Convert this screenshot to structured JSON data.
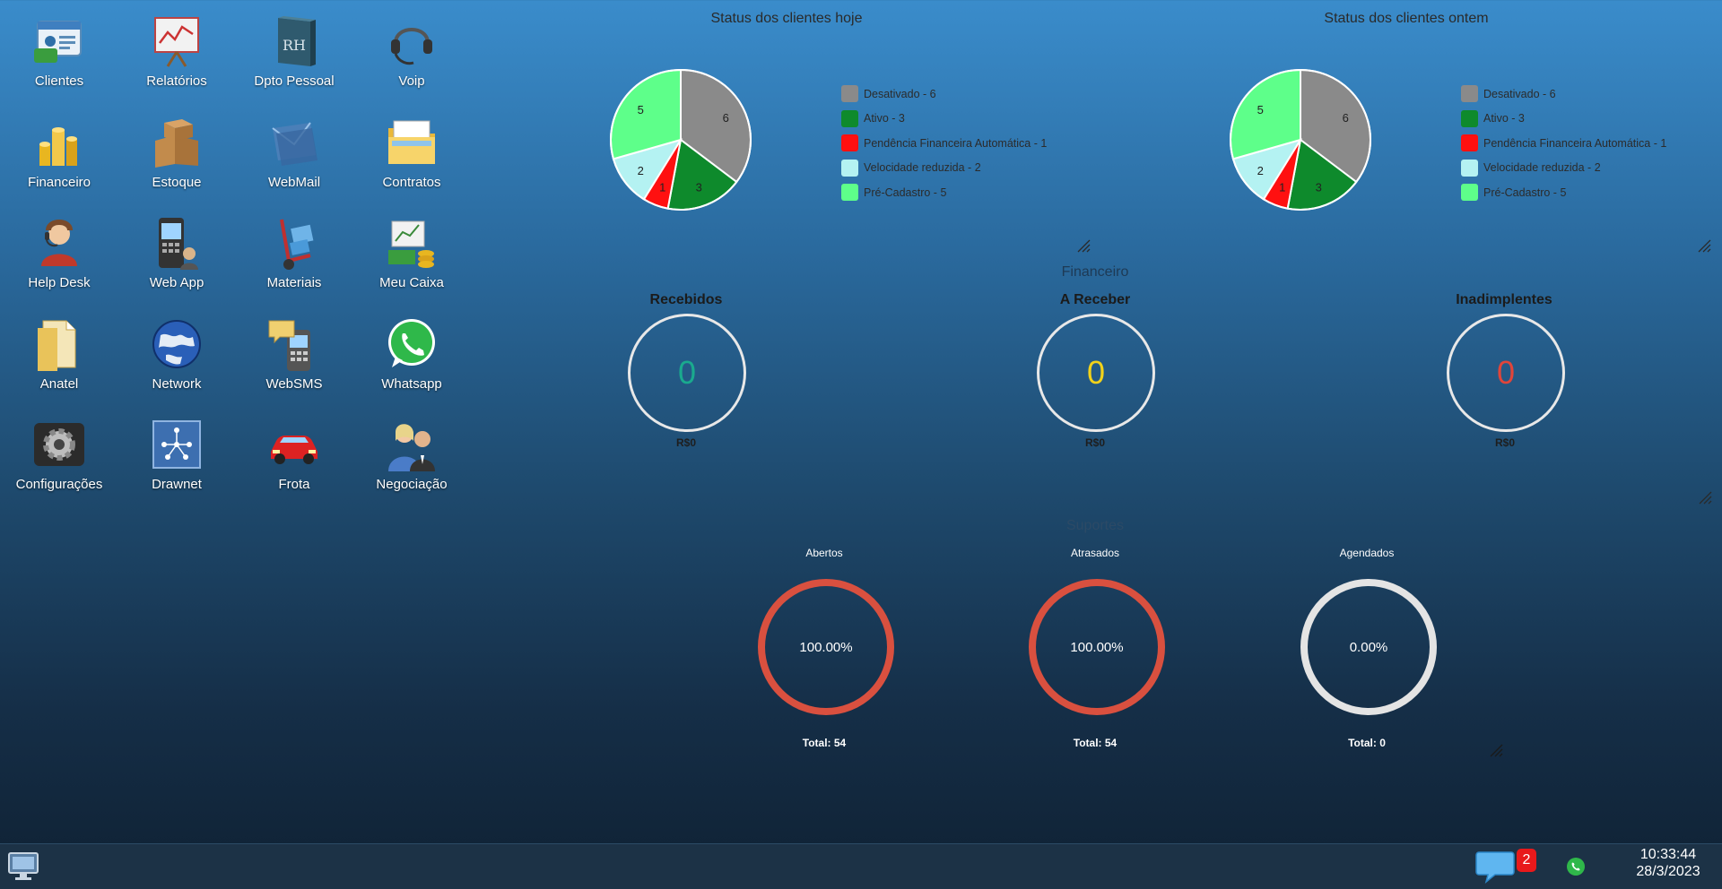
{
  "desktop": {
    "icons": [
      {
        "label": "Clientes",
        "icon": "clients-card-icon"
      },
      {
        "label": "Relatórios",
        "icon": "report-board-icon"
      },
      {
        "label": "Dpto Pessoal",
        "icon": "rh-book-icon"
      },
      {
        "label": "Voip",
        "icon": "headset-icon"
      },
      {
        "label": "Financeiro",
        "icon": "coins-icon"
      },
      {
        "label": "Estoque",
        "icon": "boxes-icon"
      },
      {
        "label": "WebMail",
        "icon": "mail-icon"
      },
      {
        "label": "Contratos",
        "icon": "folder-icon"
      },
      {
        "label": "Help Desk",
        "icon": "helpdesk-person-icon"
      },
      {
        "label": "Web App",
        "icon": "phone-app-icon"
      },
      {
        "label": "Materiais",
        "icon": "hand-truck-icon"
      },
      {
        "label": "Meu Caixa",
        "icon": "cash-register-icon"
      },
      {
        "label": "Anatel",
        "icon": "document-folder-icon"
      },
      {
        "label": "Network",
        "icon": "globe-icon"
      },
      {
        "label": "WebSMS",
        "icon": "sms-phone-icon"
      },
      {
        "label": "Whatsapp",
        "icon": "whatsapp-icon"
      },
      {
        "label": "Configurações",
        "icon": "gear-icon"
      },
      {
        "label": "Drawnet",
        "icon": "network-diagram-icon"
      },
      {
        "label": "Frota",
        "icon": "car-icon"
      },
      {
        "label": "Negociação",
        "icon": "people-icon"
      }
    ]
  },
  "colors": {
    "desativado": "#8a8a8a",
    "ativo": "#0e8a2c",
    "pendencia": "#ff1010",
    "velocidade": "#b4f2f2",
    "precadastro": "#5eff8a",
    "recebidos": "#1aaa8e",
    "a_receber": "#f2d21a",
    "inadimplentes": "#e0453a",
    "ring_red": "#d9503f",
    "ring_grey": "#e4e4e4"
  },
  "status_hoje": {
    "title": "Status dos clientes hoje",
    "legend": [
      "Desativado - 6",
      "Ativo - 3",
      "Pendência Financeira Automática - 1",
      "Velocidade reduzida - 2",
      "Pré-Cadastro - 5"
    ]
  },
  "status_ontem": {
    "title": "Status dos clientes ontem",
    "legend": [
      "Desativado - 6",
      "Ativo - 3",
      "Pendência Financeira Automática - 1",
      "Velocidade reduzida - 2",
      "Pré-Cadastro - 5"
    ]
  },
  "chart_data": [
    {
      "type": "pie",
      "title": "Status dos clientes hoje",
      "categories": [
        "Desativado",
        "Ativo",
        "Pendência Financeira Automática",
        "Velocidade reduzida",
        "Pré-Cadastro"
      ],
      "values": [
        6,
        3,
        1,
        2,
        5
      ],
      "colors": [
        "#8a8a8a",
        "#0e8a2c",
        "#ff1010",
        "#b4f2f2",
        "#5eff8a"
      ]
    },
    {
      "type": "pie",
      "title": "Status dos clientes ontem",
      "categories": [
        "Desativado",
        "Ativo",
        "Pendência Financeira Automática",
        "Velocidade reduzida",
        "Pré-Cadastro"
      ],
      "values": [
        6,
        3,
        1,
        2,
        5
      ],
      "colors": [
        "#8a8a8a",
        "#0e8a2c",
        "#ff1010",
        "#b4f2f2",
        "#5eff8a"
      ]
    }
  ],
  "financeiro": {
    "title": "Financeiro",
    "recebidos": {
      "label": "Recebidos",
      "value": "0",
      "amount": "R$0"
    },
    "a_receber": {
      "label": "A Receber",
      "value": "0",
      "amount": "R$0"
    },
    "inadimplentes": {
      "label": "Inadimplentes",
      "value": "0",
      "amount": "R$0"
    }
  },
  "suportes": {
    "title": "Suportes",
    "abertos": {
      "label": "Abertos",
      "percent": "100.00%",
      "total": "Total: 54"
    },
    "atrasados": {
      "label": "Atrasados",
      "percent": "100.00%",
      "total": "Total: 54"
    },
    "agendados": {
      "label": "Agendados",
      "percent": "0.00%",
      "total": "Total: 0"
    }
  },
  "taskbar": {
    "chat_badge": "2",
    "time": "10:33:44",
    "date": "28/3/2023"
  }
}
